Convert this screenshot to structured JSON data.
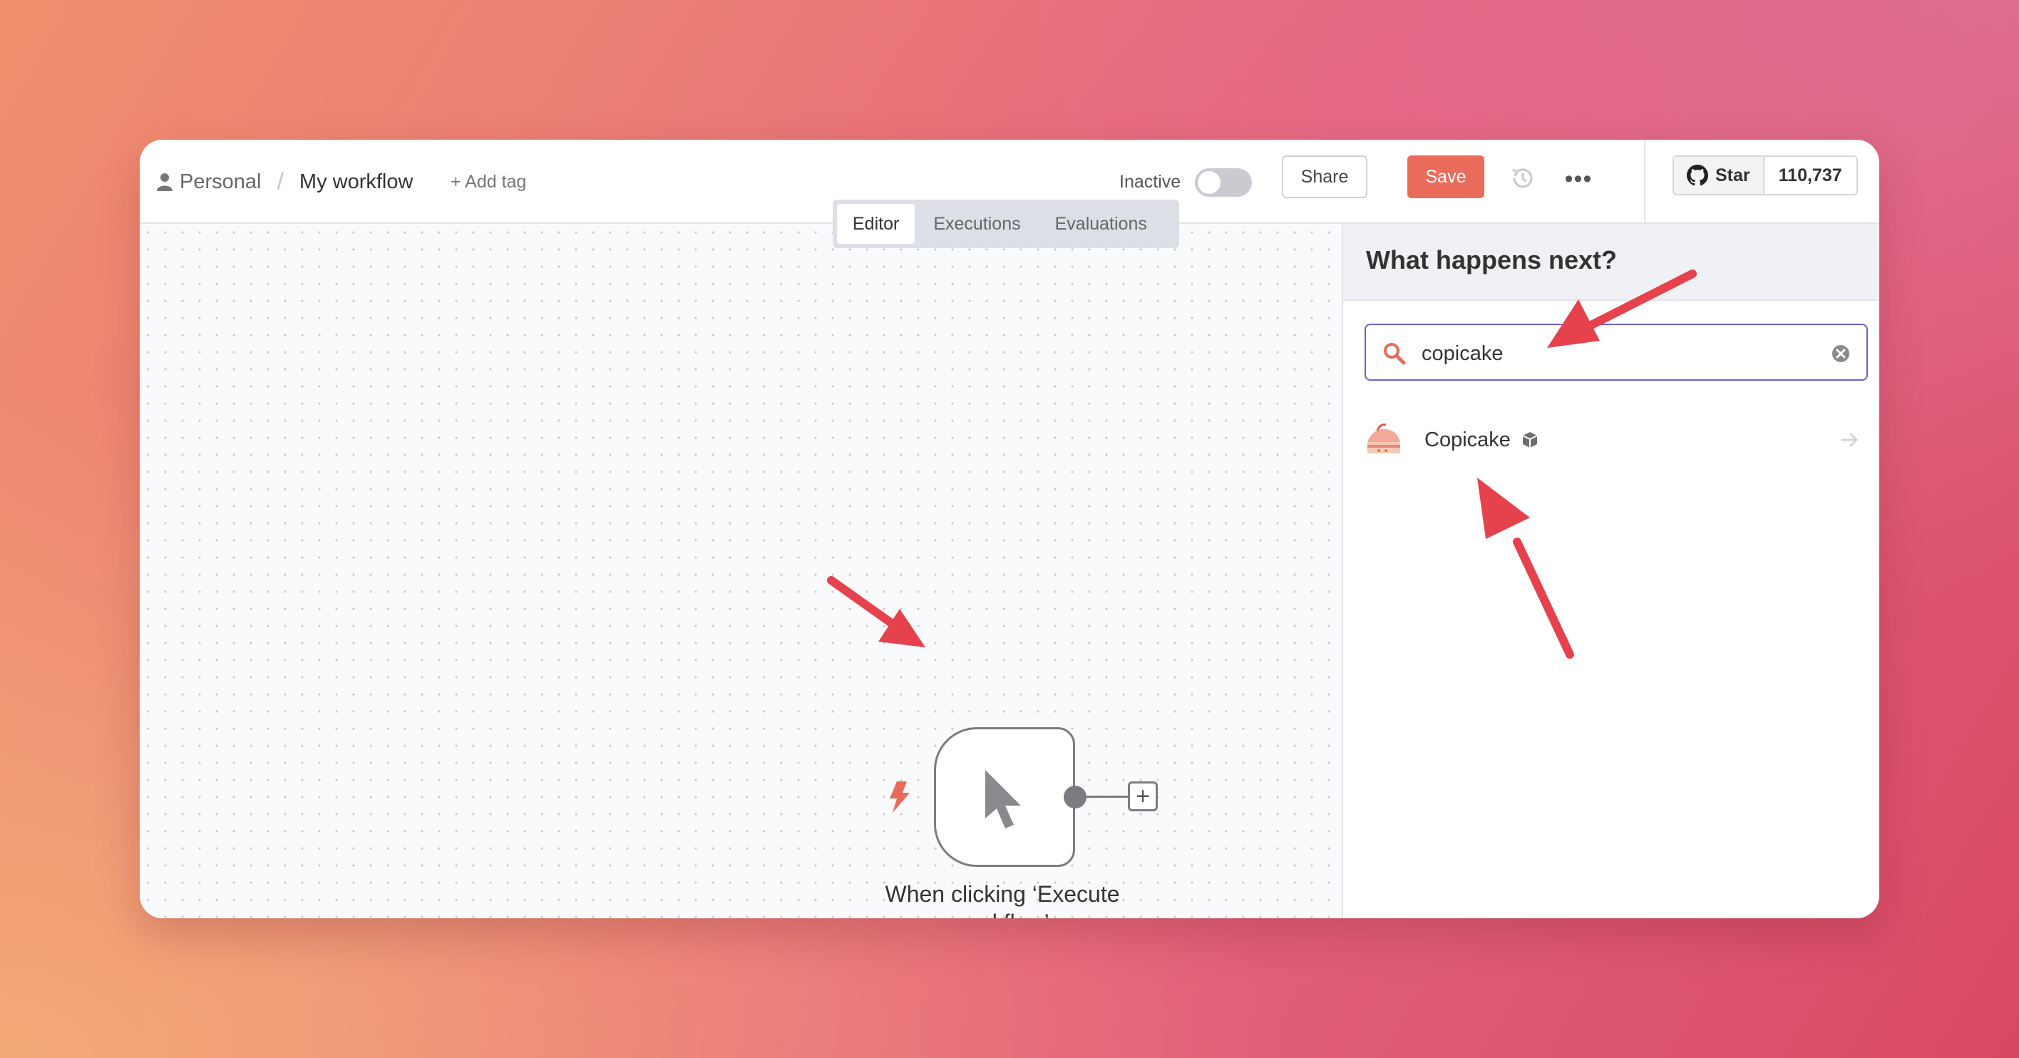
{
  "header": {
    "workspace": "Personal",
    "separator": "/",
    "workflow_name": "My workflow",
    "add_tag": "+ Add tag",
    "status_label": "Inactive",
    "share_label": "Share",
    "save_label": "Save",
    "more_label": "•••",
    "github": {
      "star_label": "Star",
      "star_count": "110,737"
    }
  },
  "tabs": [
    {
      "label": "Editor",
      "active": true
    },
    {
      "label": "Executions",
      "active": false
    },
    {
      "label": "Evaluations",
      "active": false
    }
  ],
  "canvas": {
    "trigger_node": {
      "label": "When clicking ‘Execute workflow’",
      "icon": "cursor-icon"
    },
    "add_node_label": "+"
  },
  "panel": {
    "title": "What happens next?",
    "search": {
      "value": "copicake"
    },
    "results": [
      {
        "name": "Copicake",
        "icon": "copicake-logo",
        "badge": "package-icon"
      }
    ]
  },
  "colors": {
    "accent": "#ea6b5a",
    "search_border": "#6b5fd0",
    "annotation_arrow": "#e5424d"
  }
}
